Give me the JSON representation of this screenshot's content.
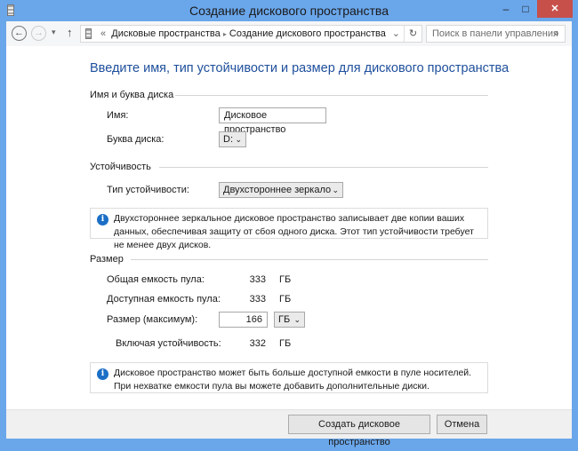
{
  "window": {
    "title": "Создание дискового пространства",
    "minimize": "–",
    "maximize": "□",
    "close": "✕"
  },
  "nav": {
    "back": "←",
    "forward": "→",
    "recent": "▾",
    "up": "↑",
    "breadcrumb_sep": "«",
    "breadcrumb": [
      "Дисковые пространства",
      "Создание дискового пространства"
    ],
    "arrow": "▸",
    "dropdown": "⌄",
    "refresh": "↻",
    "search_placeholder": "Поиск в панели управления",
    "search_icon": "⌕"
  },
  "heading": "Введите имя, тип устойчивости и размер для дискового пространства",
  "name_section": {
    "title": "Имя и буква диска",
    "name_label": "Имя:",
    "name_value": "Дисковое пространство",
    "letter_label": "Буква диска:",
    "letter_value": "D:"
  },
  "resiliency": {
    "title": "Устойчивость",
    "type_label": "Тип устойчивости:",
    "type_value": "Двухстороннее зеркало",
    "info": "Двухстороннее зеркальное дисковое пространство записывает две копии ваших данных, обеспечивая защиту от сбоя одного диска. Этот тип устойчивости требует не менее двух дисков."
  },
  "size": {
    "title": "Размер",
    "total_label": "Общая емкость пула:",
    "total_value": "333",
    "total_unit": "ГБ",
    "avail_label": "Доступная емкость пула:",
    "avail_value": "333",
    "avail_unit": "ГБ",
    "size_label": "Размер (максимум):",
    "size_value": "166",
    "size_unit": "ГБ",
    "incl_label": "Включая устойчивость:",
    "incl_value": "332",
    "incl_unit": "ГБ",
    "info": "Дисковое пространство может быть больше доступной емкости в пуле носителей. При нехватке емкости пула вы можете добавить дополнительные диски."
  },
  "buttons": {
    "create": "Создать дисковое пространство",
    "cancel": "Отмена"
  },
  "chev": "⌄"
}
